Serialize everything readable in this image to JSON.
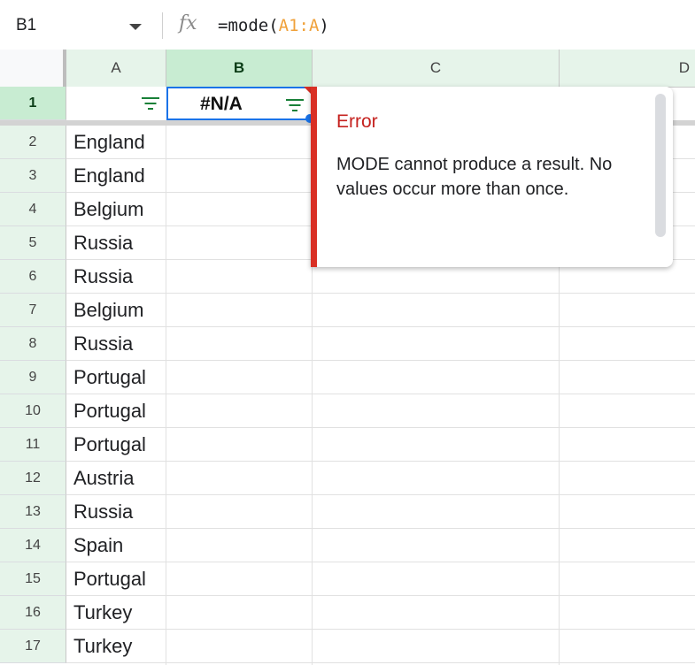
{
  "formula_bar": {
    "cell_ref": "B1",
    "fx_label": "fx",
    "formula_prefix": "=mode(",
    "formula_ref": "A1:A",
    "formula_suffix": ")"
  },
  "columns": [
    "A",
    "B",
    "C",
    "D"
  ],
  "selected_column": "B",
  "selected_row": "1",
  "cells": {
    "B1": "#N/A"
  },
  "rows": [
    {
      "num": "1",
      "a": ""
    },
    {
      "num": "2",
      "a": "England"
    },
    {
      "num": "3",
      "a": "England"
    },
    {
      "num": "4",
      "a": "Belgium"
    },
    {
      "num": "5",
      "a": "Russia"
    },
    {
      "num": "6",
      "a": "Russia"
    },
    {
      "num": "7",
      "a": "Belgium"
    },
    {
      "num": "8",
      "a": "Russia"
    },
    {
      "num": "9",
      "a": "Portugal"
    },
    {
      "num": "10",
      "a": "Portugal"
    },
    {
      "num": "11",
      "a": "Portugal"
    },
    {
      "num": "12",
      "a": "Austria"
    },
    {
      "num": "13",
      "a": "Russia"
    },
    {
      "num": "14",
      "a": "Spain"
    },
    {
      "num": "15",
      "a": "Portugal"
    },
    {
      "num": "16",
      "a": "Turkey"
    },
    {
      "num": "17",
      "a": "Turkey"
    }
  ],
  "error_popup": {
    "title": "Error",
    "message": "MODE cannot produce a result. No values occur more than once."
  },
  "colors": {
    "error_red": "#d93025",
    "selection_blue": "#1a73e8",
    "filter_green": "#188038"
  }
}
